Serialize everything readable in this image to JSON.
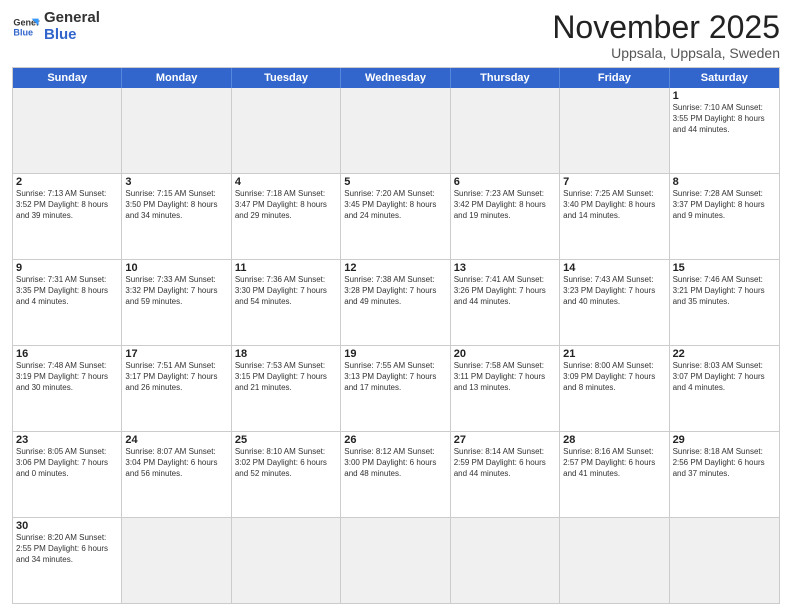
{
  "logo": {
    "text_general": "General",
    "text_blue": "Blue"
  },
  "title": "November 2025",
  "location": "Uppsala, Uppsala, Sweden",
  "header": {
    "days": [
      "Sunday",
      "Monday",
      "Tuesday",
      "Wednesday",
      "Thursday",
      "Friday",
      "Saturday"
    ]
  },
  "rows": [
    [
      {
        "day": "",
        "info": "",
        "empty": true
      },
      {
        "day": "",
        "info": "",
        "empty": true
      },
      {
        "day": "",
        "info": "",
        "empty": true
      },
      {
        "day": "",
        "info": "",
        "empty": true
      },
      {
        "day": "",
        "info": "",
        "empty": true
      },
      {
        "day": "",
        "info": "",
        "empty": true
      },
      {
        "day": "1",
        "info": "Sunrise: 7:10 AM\nSunset: 3:55 PM\nDaylight: 8 hours\nand 44 minutes.",
        "empty": false
      }
    ],
    [
      {
        "day": "2",
        "info": "Sunrise: 7:13 AM\nSunset: 3:52 PM\nDaylight: 8 hours\nand 39 minutes.",
        "empty": false
      },
      {
        "day": "3",
        "info": "Sunrise: 7:15 AM\nSunset: 3:50 PM\nDaylight: 8 hours\nand 34 minutes.",
        "empty": false
      },
      {
        "day": "4",
        "info": "Sunrise: 7:18 AM\nSunset: 3:47 PM\nDaylight: 8 hours\nand 29 minutes.",
        "empty": false
      },
      {
        "day": "5",
        "info": "Sunrise: 7:20 AM\nSunset: 3:45 PM\nDaylight: 8 hours\nand 24 minutes.",
        "empty": false
      },
      {
        "day": "6",
        "info": "Sunrise: 7:23 AM\nSunset: 3:42 PM\nDaylight: 8 hours\nand 19 minutes.",
        "empty": false
      },
      {
        "day": "7",
        "info": "Sunrise: 7:25 AM\nSunset: 3:40 PM\nDaylight: 8 hours\nand 14 minutes.",
        "empty": false
      },
      {
        "day": "8",
        "info": "Sunrise: 7:28 AM\nSunset: 3:37 PM\nDaylight: 8 hours\nand 9 minutes.",
        "empty": false
      }
    ],
    [
      {
        "day": "9",
        "info": "Sunrise: 7:31 AM\nSunset: 3:35 PM\nDaylight: 8 hours\nand 4 minutes.",
        "empty": false
      },
      {
        "day": "10",
        "info": "Sunrise: 7:33 AM\nSunset: 3:32 PM\nDaylight: 7 hours\nand 59 minutes.",
        "empty": false
      },
      {
        "day": "11",
        "info": "Sunrise: 7:36 AM\nSunset: 3:30 PM\nDaylight: 7 hours\nand 54 minutes.",
        "empty": false
      },
      {
        "day": "12",
        "info": "Sunrise: 7:38 AM\nSunset: 3:28 PM\nDaylight: 7 hours\nand 49 minutes.",
        "empty": false
      },
      {
        "day": "13",
        "info": "Sunrise: 7:41 AM\nSunset: 3:26 PM\nDaylight: 7 hours\nand 44 minutes.",
        "empty": false
      },
      {
        "day": "14",
        "info": "Sunrise: 7:43 AM\nSunset: 3:23 PM\nDaylight: 7 hours\nand 40 minutes.",
        "empty": false
      },
      {
        "day": "15",
        "info": "Sunrise: 7:46 AM\nSunset: 3:21 PM\nDaylight: 7 hours\nand 35 minutes.",
        "empty": false
      }
    ],
    [
      {
        "day": "16",
        "info": "Sunrise: 7:48 AM\nSunset: 3:19 PM\nDaylight: 7 hours\nand 30 minutes.",
        "empty": false
      },
      {
        "day": "17",
        "info": "Sunrise: 7:51 AM\nSunset: 3:17 PM\nDaylight: 7 hours\nand 26 minutes.",
        "empty": false
      },
      {
        "day": "18",
        "info": "Sunrise: 7:53 AM\nSunset: 3:15 PM\nDaylight: 7 hours\nand 21 minutes.",
        "empty": false
      },
      {
        "day": "19",
        "info": "Sunrise: 7:55 AM\nSunset: 3:13 PM\nDaylight: 7 hours\nand 17 minutes.",
        "empty": false
      },
      {
        "day": "20",
        "info": "Sunrise: 7:58 AM\nSunset: 3:11 PM\nDaylight: 7 hours\nand 13 minutes.",
        "empty": false
      },
      {
        "day": "21",
        "info": "Sunrise: 8:00 AM\nSunset: 3:09 PM\nDaylight: 7 hours\nand 8 minutes.",
        "empty": false
      },
      {
        "day": "22",
        "info": "Sunrise: 8:03 AM\nSunset: 3:07 PM\nDaylight: 7 hours\nand 4 minutes.",
        "empty": false
      }
    ],
    [
      {
        "day": "23",
        "info": "Sunrise: 8:05 AM\nSunset: 3:06 PM\nDaylight: 7 hours\nand 0 minutes.",
        "empty": false
      },
      {
        "day": "24",
        "info": "Sunrise: 8:07 AM\nSunset: 3:04 PM\nDaylight: 6 hours\nand 56 minutes.",
        "empty": false
      },
      {
        "day": "25",
        "info": "Sunrise: 8:10 AM\nSunset: 3:02 PM\nDaylight: 6 hours\nand 52 minutes.",
        "empty": false
      },
      {
        "day": "26",
        "info": "Sunrise: 8:12 AM\nSunset: 3:00 PM\nDaylight: 6 hours\nand 48 minutes.",
        "empty": false
      },
      {
        "day": "27",
        "info": "Sunrise: 8:14 AM\nSunset: 2:59 PM\nDaylight: 6 hours\nand 44 minutes.",
        "empty": false
      },
      {
        "day": "28",
        "info": "Sunrise: 8:16 AM\nSunset: 2:57 PM\nDaylight: 6 hours\nand 41 minutes.",
        "empty": false
      },
      {
        "day": "29",
        "info": "Sunrise: 8:18 AM\nSunset: 2:56 PM\nDaylight: 6 hours\nand 37 minutes.",
        "empty": false
      }
    ],
    [
      {
        "day": "30",
        "info": "Sunrise: 8:20 AM\nSunset: 2:55 PM\nDaylight: 6 hours\nand 34 minutes.",
        "empty": false
      },
      {
        "day": "",
        "info": "",
        "empty": true
      },
      {
        "day": "",
        "info": "",
        "empty": true
      },
      {
        "day": "",
        "info": "",
        "empty": true
      },
      {
        "day": "",
        "info": "",
        "empty": true
      },
      {
        "day": "",
        "info": "",
        "empty": true
      },
      {
        "day": "",
        "info": "",
        "empty": true
      }
    ]
  ]
}
